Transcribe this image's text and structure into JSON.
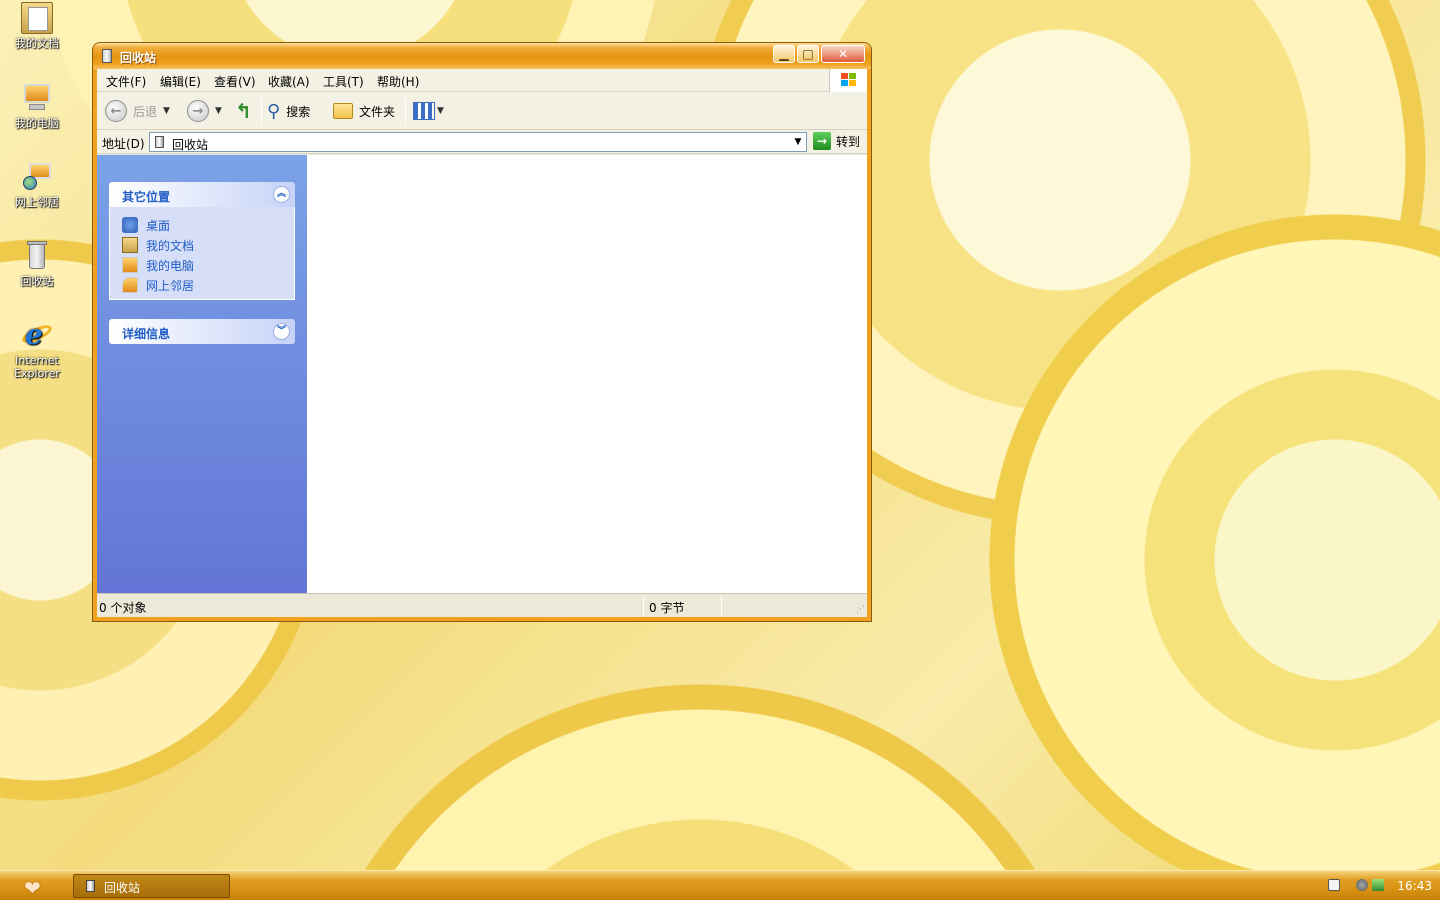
{
  "desktop": {
    "icons": [
      {
        "label": "我的文档"
      },
      {
        "label": "我的电脑"
      },
      {
        "label": "网上邻居"
      },
      {
        "label": "回收站"
      },
      {
        "label": "Internet Explorer"
      }
    ]
  },
  "window": {
    "title": "回收站",
    "menu": [
      "文件(F)",
      "编辑(E)",
      "查看(V)",
      "收藏(A)",
      "工具(T)",
      "帮助(H)"
    ],
    "toolbar": {
      "back": "后退",
      "search": "搜索",
      "folders": "文件夹"
    },
    "address": {
      "label": "地址(D)",
      "value": "回收站",
      "go": "转到"
    },
    "panels": {
      "other_places": {
        "title": "其它位置",
        "links": [
          "桌面",
          "我的文档",
          "我的电脑",
          "网上邻居"
        ]
      },
      "details": {
        "title": "详细信息"
      }
    },
    "status": {
      "objects": "0 个对象",
      "size": "0 字节"
    }
  },
  "taskbar": {
    "task_label": "回收站",
    "clock": "16:43"
  },
  "colors": {
    "titlebar": "#e39513",
    "taskbar": "#d99515",
    "pane_top": "#7ba2e7",
    "pane_bottom": "#6375d6",
    "link": "#215dc6"
  }
}
